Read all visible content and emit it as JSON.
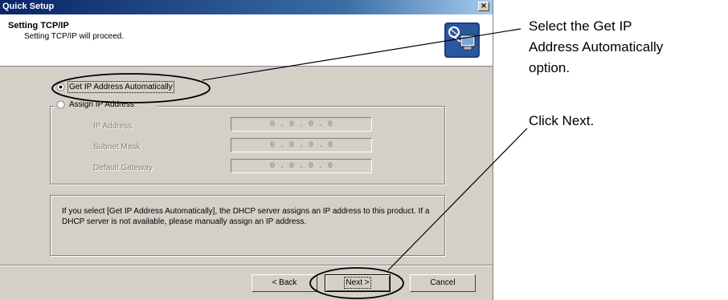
{
  "window": {
    "title": "Quick Setup",
    "close_glyph": "×"
  },
  "header": {
    "title": "Setting TCP/IP",
    "subtitle": "Setting TCP/IP will proceed.",
    "icon": "network-setup-icon"
  },
  "options": {
    "auto_label": "Get IP Address Automatically",
    "auto_selected": true,
    "assign_label": "Assign IP Address",
    "assign_selected": false
  },
  "fields": [
    {
      "label": "IP Address",
      "value": "0 . 0 . 0 . 0"
    },
    {
      "label": "Subnet Mask",
      "value": "0 . 0 . 0 . 0"
    },
    {
      "label": "Default Gateway",
      "value": "0 . 0 . 0 . 0"
    }
  ],
  "info": {
    "text": "If you select [Get IP Address Automatically], the DHCP server assigns an IP address to this product. If a DHCP server is not available, please manually assign an IP address."
  },
  "buttons": {
    "back": "< Back",
    "next": "Next >",
    "cancel": "Cancel"
  },
  "annotations": {
    "select_line1": "Select the Get IP",
    "select_line2": "Address Automatically",
    "select_line3": "option.",
    "click_next": "Click Next."
  }
}
